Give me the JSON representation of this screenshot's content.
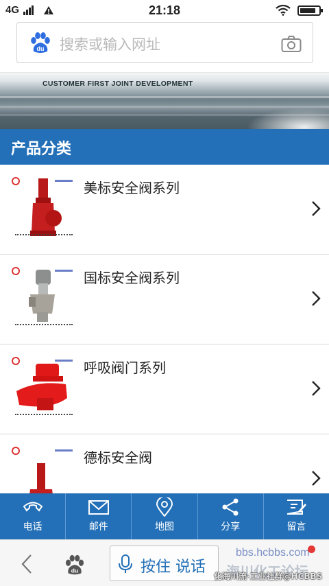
{
  "status_bar": {
    "network": "4G",
    "time": "21:18",
    "battery_level": 0.85
  },
  "browser": {
    "search_placeholder": "搜索或输入网址",
    "back_icon": "chevron-left-icon",
    "home_icon": "baidu-paw-icon",
    "voice_label": "按住 说话"
  },
  "banner": {
    "tagline": "CUSTOMER FIRST JOINT DEVELOPMENT"
  },
  "section": {
    "title": "产品分类"
  },
  "products": [
    {
      "name": "美标安全阀系列",
      "image": "red-safety-valve-photo"
    },
    {
      "name": "国标安全阀系列",
      "image": "silver-safety-valve-photo"
    },
    {
      "name": "呼吸阀门系列",
      "image": "red-breather-valve-photo"
    },
    {
      "name": "德标安全阀",
      "image": "red-safety-valve-photo"
    }
  ],
  "tabbar": [
    {
      "label": "电话",
      "icon": "phone-icon"
    },
    {
      "label": "邮件",
      "icon": "mail-icon"
    },
    {
      "label": "地图",
      "icon": "map-pin-icon"
    },
    {
      "label": "分享",
      "icon": "share-icon"
    },
    {
      "label": "留言",
      "icon": "message-icon"
    }
  ],
  "watermark": {
    "url": "bbs.hcbbs.com",
    "logo_text": "海川化工论坛",
    "caption": "化海川流·工业社群@HCBBS"
  },
  "colors": {
    "primary": "#2370b8",
    "tab_divider": "#5d9bd6",
    "placeholder": "#b9b9b9"
  }
}
